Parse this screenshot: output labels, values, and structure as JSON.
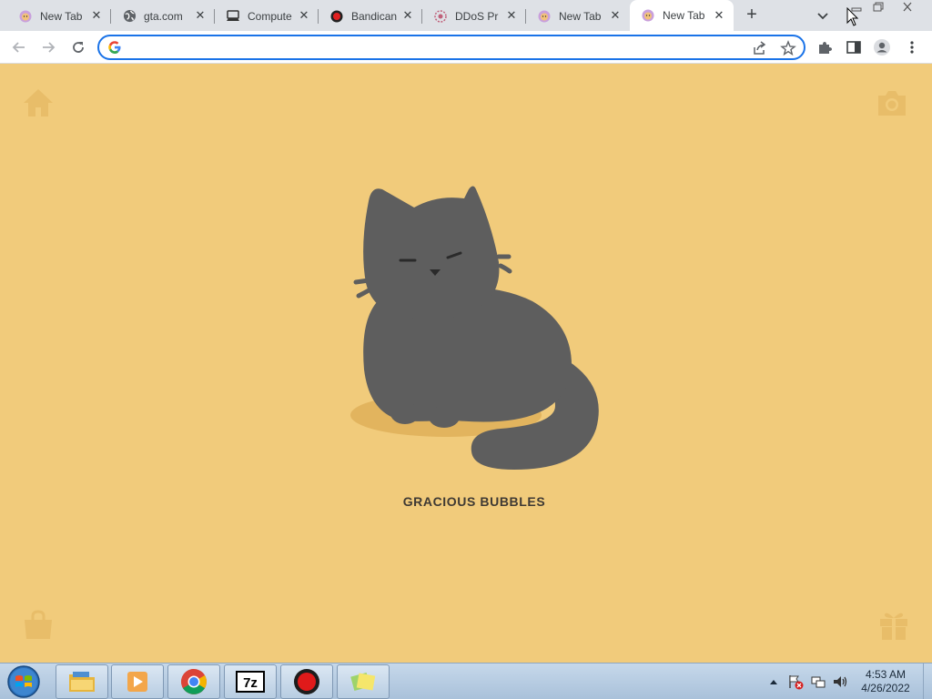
{
  "browser": {
    "tabs": [
      {
        "title": "New Tab",
        "icon": "cat-face-icon"
      },
      {
        "title": "gta.com",
        "icon": "globe-icon"
      },
      {
        "title": "Compute",
        "icon": "computer-icon"
      },
      {
        "title": "Bandican",
        "icon": "bandicam-record-icon"
      },
      {
        "title": "DDoS Pr",
        "icon": "ddos-icon"
      },
      {
        "title": "New Tab",
        "icon": "cat-face-icon"
      },
      {
        "title": "New Tab",
        "icon": "cat-face-icon",
        "active": true
      }
    ],
    "address_bar": {
      "value": "",
      "placeholder": ""
    }
  },
  "page": {
    "cat_name": "GRACIOUS BUBBLES",
    "background_color": "#f1cb7b",
    "cat_color": "#5e5e5e",
    "corner_icons": [
      "home-icon",
      "camera-icon",
      "shopping-bag-icon",
      "gift-icon"
    ]
  },
  "taskbar": {
    "apps": [
      "file-explorer-icon",
      "media-player-icon",
      "chrome-icon",
      "7zip-icon",
      "bandicam-icon",
      "sticky-notes-icon"
    ],
    "clock": {
      "time": "4:53 AM",
      "date": "4/26/2022"
    }
  }
}
